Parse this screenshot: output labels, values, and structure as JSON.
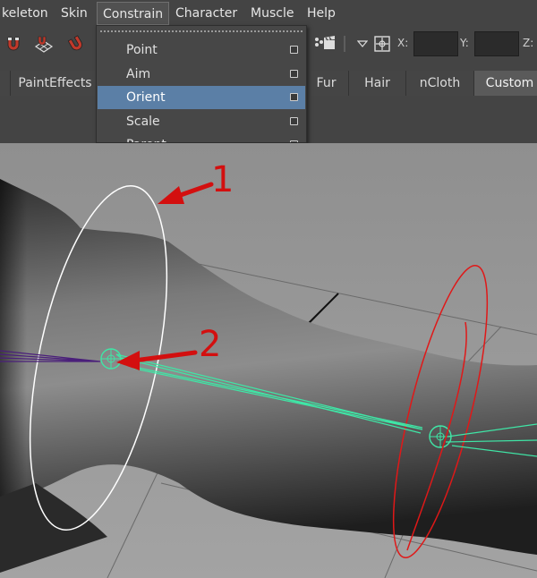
{
  "menubar": {
    "items": [
      "keleton",
      "Skin",
      "Constrain",
      "Character",
      "Muscle",
      "Help"
    ]
  },
  "status_line": {
    "x_label": "X:",
    "y_label": "Y:",
    "z_label": "Z:"
  },
  "shelf": {
    "tabs": [
      "PaintEffects",
      "Fur",
      "Hair",
      "nCloth",
      "Custom"
    ],
    "selected": "Custom"
  },
  "constrain_menu": {
    "items": [
      "Point",
      "Aim",
      "Orient",
      "Scale",
      "Parent"
    ],
    "highlighted": "Orient"
  },
  "annotations": [
    "1",
    "2"
  ],
  "colors": {
    "ui_background": "#444444",
    "highlight": "#5b7fa6",
    "annotation_red": "#d30f0f",
    "joint_green": "#3fe6a6",
    "control_white": "#ffffff",
    "control_red": "#e01818"
  }
}
